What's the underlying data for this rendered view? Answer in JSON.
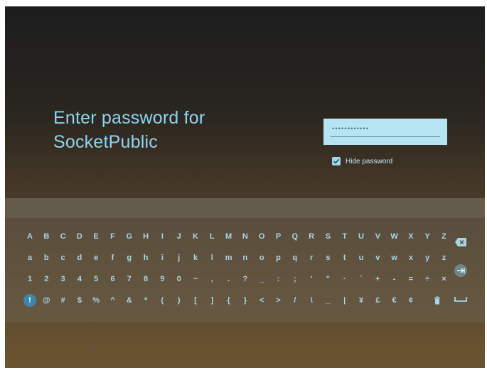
{
  "prompt": {
    "line1": "Enter password for",
    "line2": "SocketPublic"
  },
  "password": {
    "masked_value": "••••••••••••"
  },
  "hide_password": {
    "label": "Hide password",
    "checked": true
  },
  "keyboard": {
    "rows": [
      [
        "A",
        "B",
        "C",
        "D",
        "E",
        "F",
        "G",
        "H",
        "I",
        "J",
        "K",
        "L",
        "M",
        "N",
        "O",
        "P",
        "Q",
        "R",
        "S",
        "T",
        "U",
        "V",
        "W",
        "X",
        "Y",
        "Z"
      ],
      [
        "a",
        "b",
        "c",
        "d",
        "e",
        "f",
        "g",
        "h",
        "i",
        "j",
        "k",
        "l",
        "m",
        "n",
        "o",
        "p",
        "q",
        "r",
        "s",
        "t",
        "u",
        "v",
        "w",
        "x",
        "y",
        "z"
      ],
      [
        "1",
        "2",
        "3",
        "4",
        "5",
        "6",
        "7",
        "8",
        "9",
        "0",
        "~",
        ",",
        ".",
        "?",
        "_",
        ":",
        ";",
        "'",
        "\"",
        "·",
        "`",
        "+",
        "-",
        "=",
        "÷",
        "×"
      ],
      [
        "!",
        "@",
        "#",
        "$",
        "%",
        "^",
        "&",
        "*",
        "(",
        ")",
        "[",
        "]",
        "{",
        "}",
        "<",
        ">",
        "/",
        "\\",
        "_",
        "|",
        "¥",
        "£",
        "€",
        "¢"
      ]
    ],
    "selected_key": "!",
    "side_keys": [
      "backspace-icon",
      "tab-icon",
      "space-icon"
    ],
    "trash_icon": "trash-icon"
  },
  "colors": {
    "accent": "#8ed3ef",
    "field_bg": "#b7e4f3",
    "key_text": "#a9d6e6",
    "selected_key_bg": "#3d86b0"
  }
}
